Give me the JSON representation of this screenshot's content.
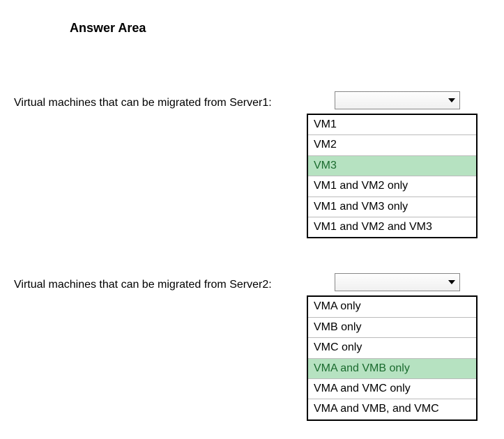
{
  "title": "Answer Area",
  "questions": [
    {
      "label": "Virtual machines that can be migrated from Server1:",
      "options": [
        {
          "text": "VM1",
          "highlighted": false
        },
        {
          "text": "VM2",
          "highlighted": false
        },
        {
          "text": "VM3",
          "highlighted": true
        },
        {
          "text": "VM1 and VM2 only",
          "highlighted": false
        },
        {
          "text": "VM1 and VM3 only",
          "highlighted": false
        },
        {
          "text": "VM1 and VM2 and VM3",
          "highlighted": false
        }
      ]
    },
    {
      "label": "Virtual machines that can be migrated from Server2:",
      "options": [
        {
          "text": "VMA only",
          "highlighted": false
        },
        {
          "text": "VMB only",
          "highlighted": false
        },
        {
          "text": "VMC only",
          "highlighted": false
        },
        {
          "text": "VMA and VMB only",
          "highlighted": true
        },
        {
          "text": "VMA and VMC only",
          "highlighted": false
        },
        {
          "text": "VMA and VMB, and VMC",
          "highlighted": false
        }
      ]
    }
  ]
}
